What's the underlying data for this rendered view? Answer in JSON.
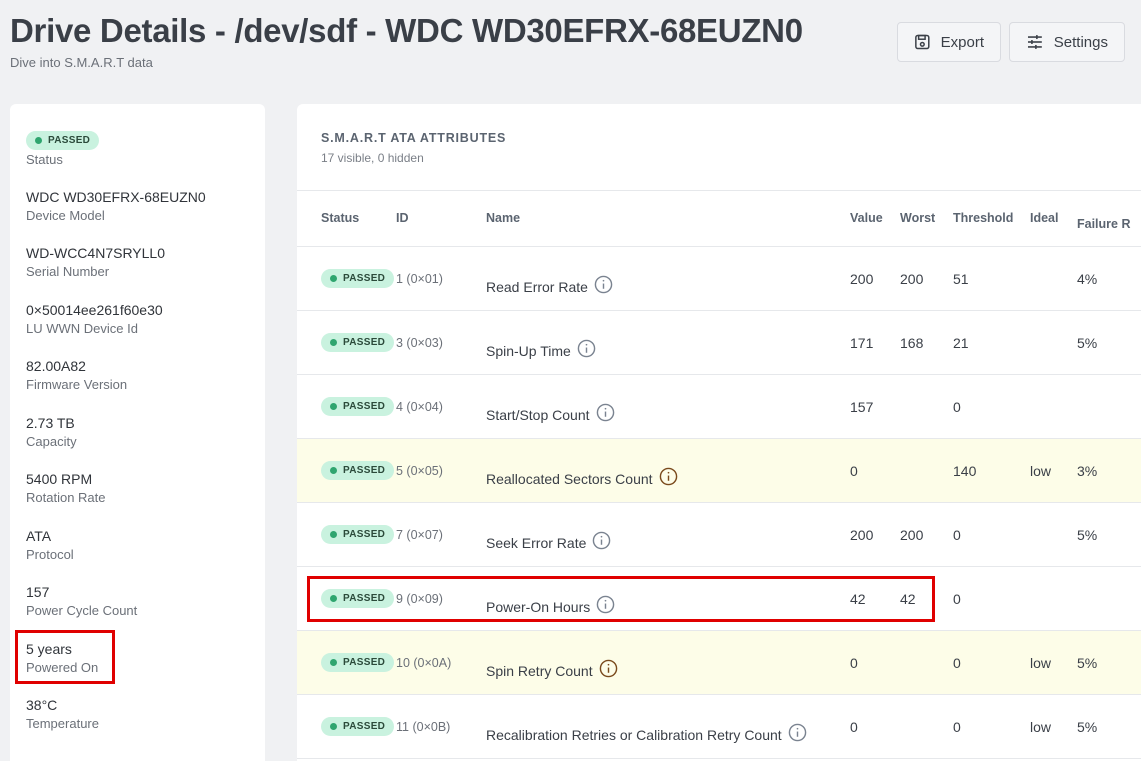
{
  "header": {
    "title": "Drive Details - /dev/sdf - WDC WD30EFRX-68EUZN0",
    "subtitle": "Dive into S.M.A.R.T data",
    "export_label": "Export",
    "settings_label": "Settings"
  },
  "summary": {
    "status_badge": "PASSED",
    "status_label": "Status",
    "items": [
      {
        "value": "WDC WD30EFRX-68EUZN0",
        "label": "Device Model"
      },
      {
        "value": "WD-WCC4N7SRYLL0",
        "label": "Serial Number"
      },
      {
        "value": "0×50014ee261f60e30",
        "label": "LU WWN Device Id"
      },
      {
        "value": "82.00A82",
        "label": "Firmware Version"
      },
      {
        "value": "2.73 TB",
        "label": "Capacity"
      },
      {
        "value": "5400 RPM",
        "label": "Rotation Rate"
      },
      {
        "value": "ATA",
        "label": "Protocol"
      },
      {
        "value": "157",
        "label": "Power Cycle Count"
      },
      {
        "value": "5 years",
        "label": "Powered On"
      },
      {
        "value": "38°C",
        "label": "Temperature"
      }
    ]
  },
  "attributes": {
    "title": "S.M.A.R.T ATA ATTRIBUTES",
    "subtitle": "17 visible, 0 hidden",
    "columns": {
      "status": "Status",
      "id": "ID",
      "name": "Name",
      "value": "Value",
      "worst": "Worst",
      "threshold": "Threshold",
      "ideal": "Ideal",
      "failure": "Failure R"
    },
    "rows": [
      {
        "status": "PASSED",
        "id": "1 (0×01)",
        "name": "Read Error Rate",
        "value": "200",
        "worst": "200",
        "threshold": "51",
        "ideal": "",
        "failure": "4%",
        "warn": false
      },
      {
        "status": "PASSED",
        "id": "3 (0×03)",
        "name": "Spin-Up Time",
        "value": "171",
        "worst": "168",
        "threshold": "21",
        "ideal": "",
        "failure": "5%",
        "warn": false
      },
      {
        "status": "PASSED",
        "id": "4 (0×04)",
        "name": "Start/Stop Count",
        "value": "157",
        "worst": "",
        "threshold": "0",
        "ideal": "",
        "failure": "",
        "warn": false
      },
      {
        "status": "PASSED",
        "id": "5 (0×05)",
        "name": "Reallocated Sectors Count",
        "value": "0",
        "worst": "",
        "threshold": "140",
        "ideal": "low",
        "failure": "3%",
        "warn": true
      },
      {
        "status": "PASSED",
        "id": "7 (0×07)",
        "name": "Seek Error Rate",
        "value": "200",
        "worst": "200",
        "threshold": "0",
        "ideal": "",
        "failure": "5%",
        "warn": false
      },
      {
        "status": "PASSED",
        "id": "9 (0×09)",
        "name": "Power-On Hours",
        "value": "42",
        "worst": "42",
        "threshold": "0",
        "ideal": "",
        "failure": "",
        "warn": false
      },
      {
        "status": "PASSED",
        "id": "10 (0×0A)",
        "name": "Spin Retry Count",
        "value": "0",
        "worst": "",
        "threshold": "0",
        "ideal": "low",
        "failure": "5%",
        "warn": true
      },
      {
        "status": "PASSED",
        "id": "11 (0×0B)",
        "name": "Recalibration Retries or Calibration Retry Count",
        "value": "0",
        "worst": "",
        "threshold": "0",
        "ideal": "low",
        "failure": "5%",
        "warn": false
      }
    ]
  },
  "colors": {
    "passed_bg": "#c9f2df",
    "passed_dot": "#2fa56f",
    "warn_row_bg": "#fdfde8",
    "highlight": "#e00000"
  }
}
